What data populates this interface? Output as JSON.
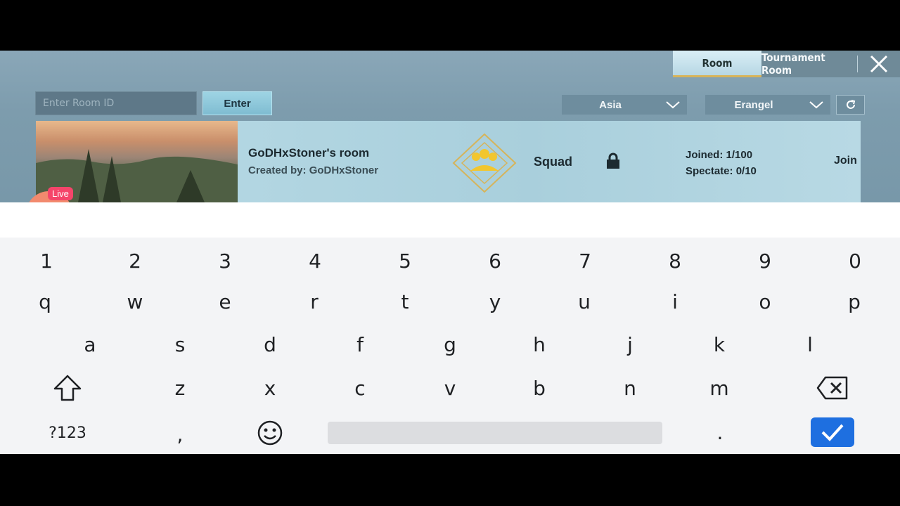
{
  "tabs": {
    "room": "Room",
    "tournament": "Tournament Room"
  },
  "room_search": {
    "placeholder": "Enter Room ID",
    "enter_label": "Enter"
  },
  "filters": {
    "region": "Asia",
    "map": "Erangel"
  },
  "room": {
    "name": "GoDHxStoner's room",
    "creator": "Created by: GoDHxStoner",
    "mode": "Squad",
    "joined": "Joined: 1/100",
    "spectate": "Spectate: 0/10",
    "join_label": "Join"
  },
  "overlay": {
    "live_label": "Live"
  },
  "keyboard": {
    "row_numbers": [
      "1",
      "2",
      "3",
      "4",
      "5",
      "6",
      "7",
      "8",
      "9",
      "0"
    ],
    "row_q": [
      "q",
      "w",
      "e",
      "r",
      "t",
      "y",
      "u",
      "i",
      "o",
      "p"
    ],
    "row_a": [
      "a",
      "s",
      "d",
      "f",
      "g",
      "h",
      "j",
      "k",
      "l"
    ],
    "row_z": [
      "z",
      "x",
      "c",
      "v",
      "b",
      "n",
      "m"
    ],
    "symbols_label": "?123",
    "comma": ",",
    "period": "."
  },
  "colors": {
    "accent_blue": "#1e6fe0",
    "tab_gold": "#d8b45a",
    "live_pink": "#f5456a"
  }
}
